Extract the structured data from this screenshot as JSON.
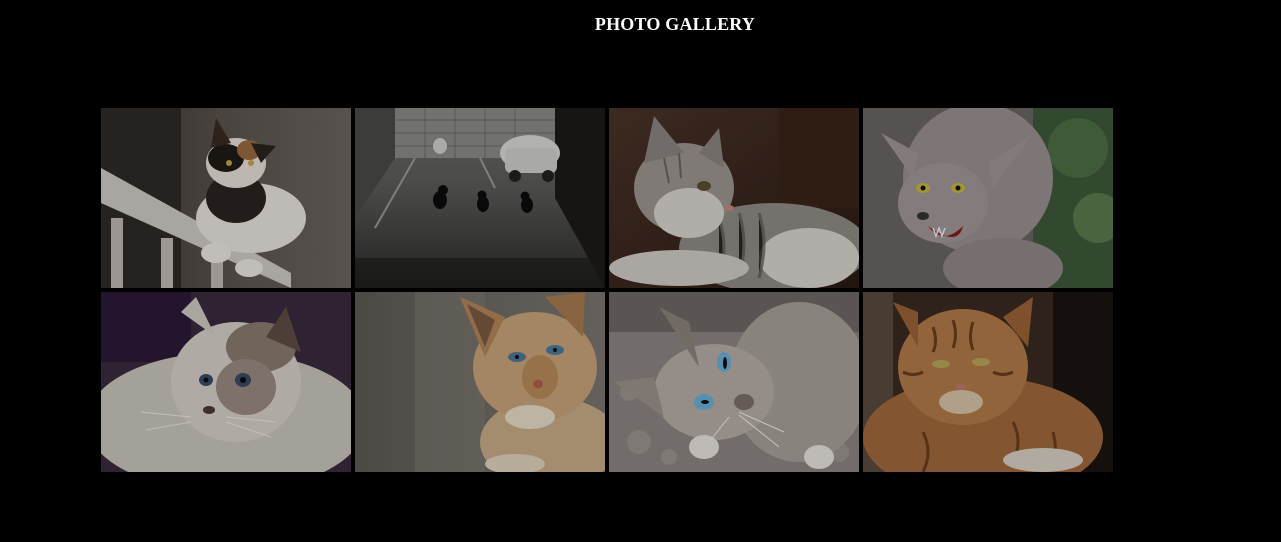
{
  "gallery": {
    "title": "PHOTO GALLERY",
    "photos": [
      {
        "name": "calico-cat-on-railing-photo"
      },
      {
        "name": "three-cats-in-alley-photo"
      },
      {
        "name": "tabby-white-cat-lying-photo"
      },
      {
        "name": "grey-cat-hissing-photo"
      },
      {
        "name": "fluffy-birman-cat-photo"
      },
      {
        "name": "cream-siamese-cat-photo"
      },
      {
        "name": "blue-eyed-cat-crouching-photo"
      },
      {
        "name": "orange-tabby-cat-photo"
      }
    ]
  },
  "colors": {
    "background": "#000000",
    "title": "#ffffff"
  }
}
